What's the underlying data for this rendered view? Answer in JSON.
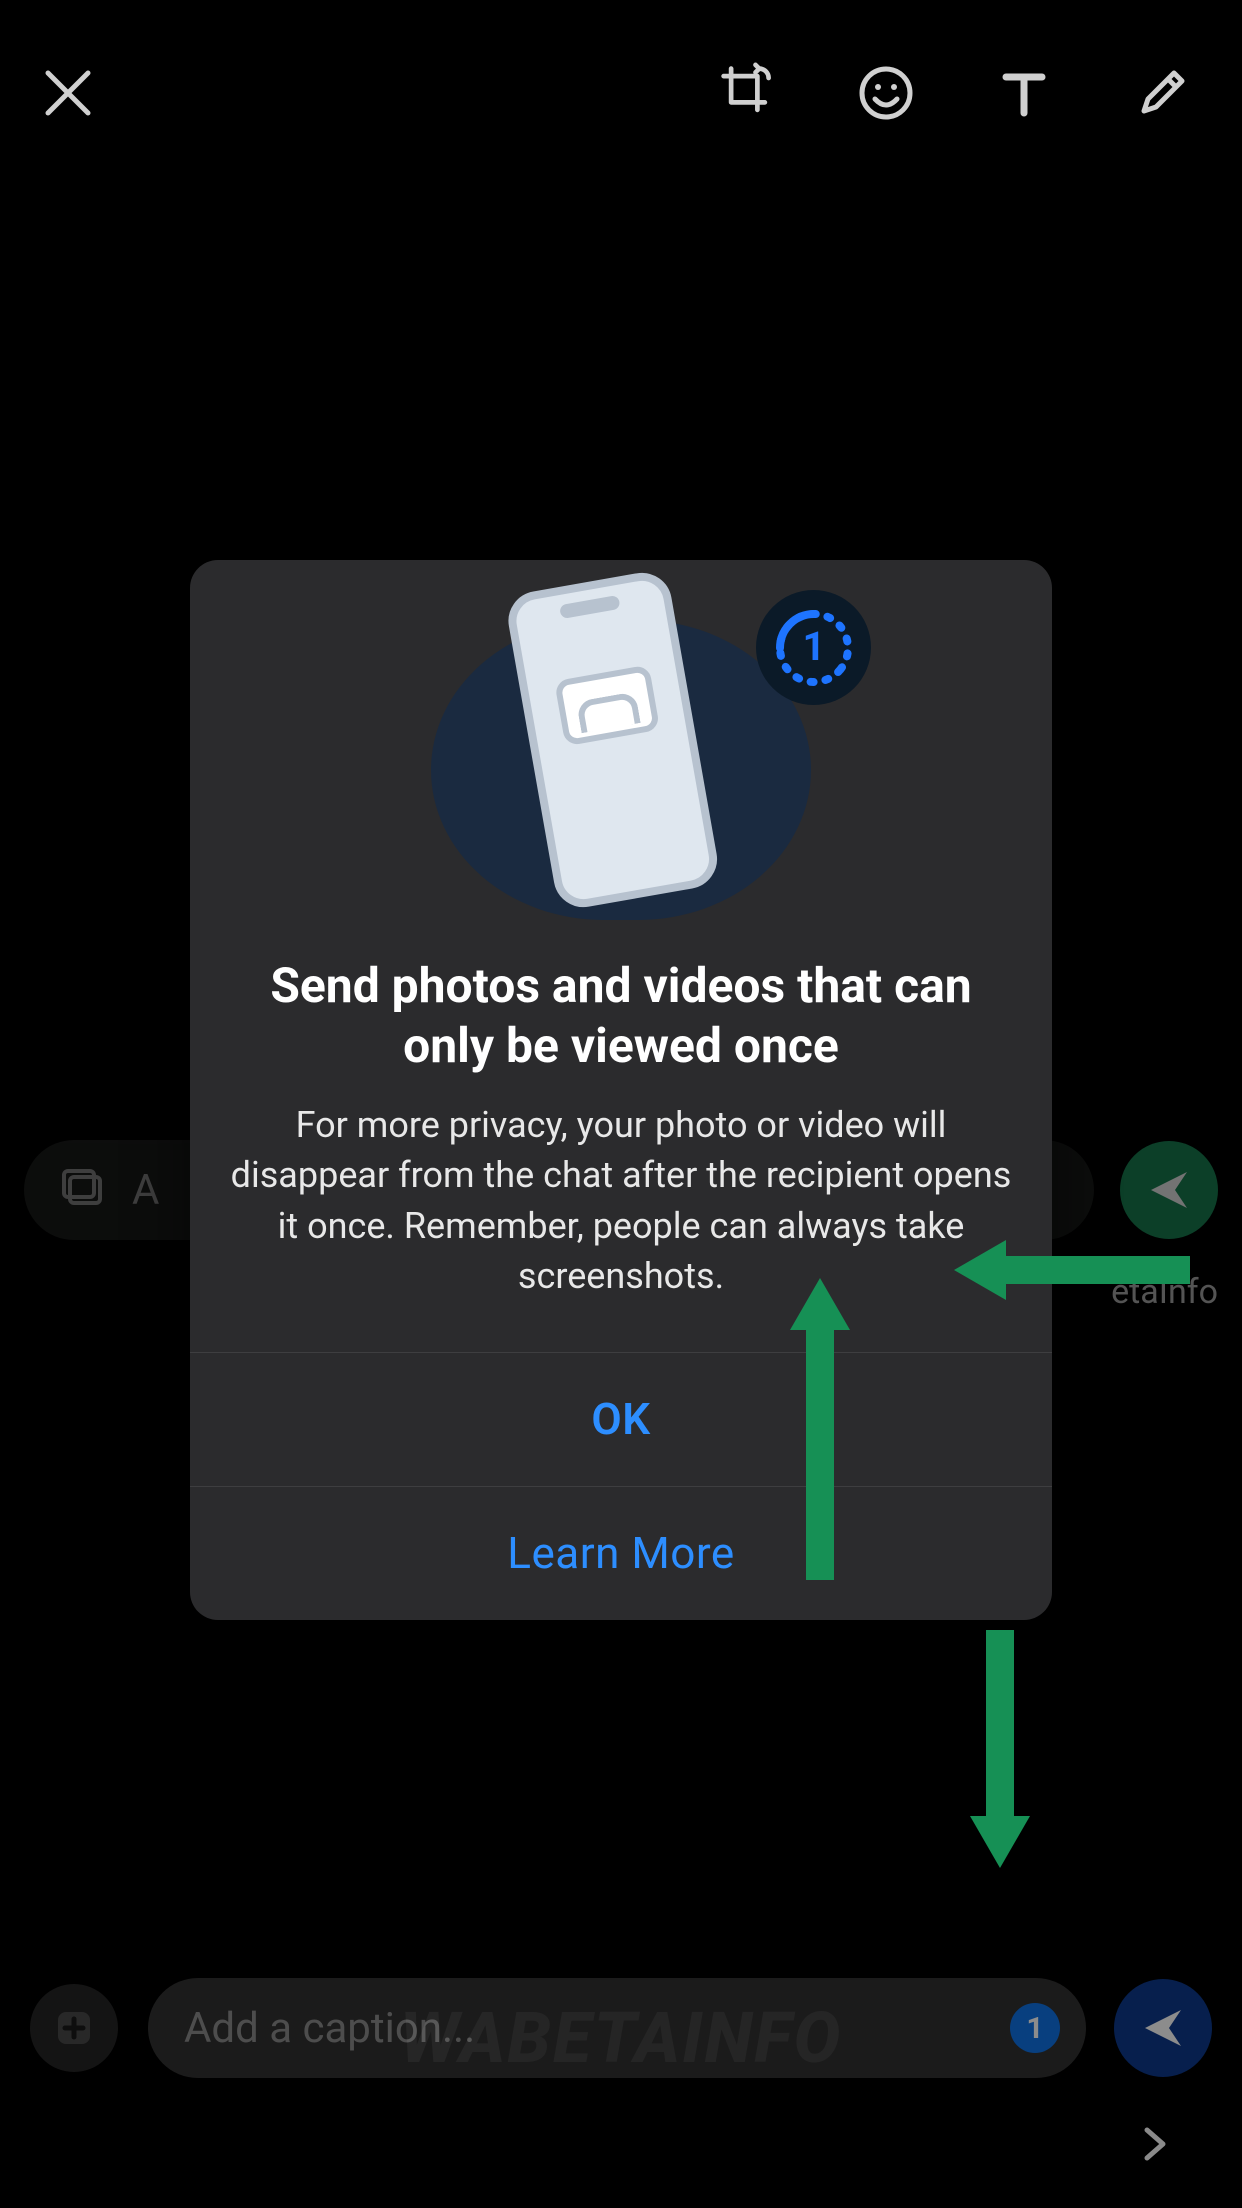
{
  "toolbar": {
    "close": "Close",
    "crop": "Crop/Rotate",
    "emoji": "Sticker/Emoji",
    "text": "Text",
    "draw": "Draw"
  },
  "midcaption": {
    "text_fragment": "A"
  },
  "modal": {
    "title": "Send photos and videos that can only be viewed once",
    "body": "For more privacy, your photo or video will disappear from the chat after the recipient opens it once. Remember, people can always take screenshots.",
    "ok": "OK",
    "learn_more": "Learn More",
    "badge_number": "1"
  },
  "caption": {
    "placeholder": "Add a caption...",
    "view_once_badge": "1"
  },
  "watermark": "WABETAINFO",
  "watermark_bottom": "WABETAINFO",
  "beta_fragment": "etaInfo"
}
